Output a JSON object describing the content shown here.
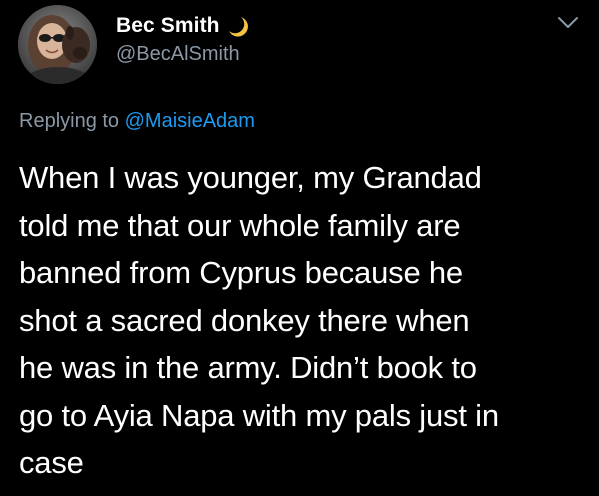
{
  "tweet": {
    "author": {
      "display_name": "Bec Smith",
      "handle": "@BecAlSmith",
      "name_emoji": "moon-icon"
    },
    "reply": {
      "prefix": "Replying to ",
      "mention": "@MaisieAdam"
    },
    "text_lines": [
      "When I was younger, my Grandad",
      "told me that our whole family are",
      "banned from Cyprus because he",
      "shot a sacred donkey there when",
      "he was in the army. Didn’t book to",
      "go to Ayia Napa with my pals just in",
      "case"
    ]
  },
  "colors": {
    "background": "#000000",
    "primary_text": "#ffffff",
    "secondary_text": "#8b98a5",
    "link": "#1d9bf0",
    "moon": "#f5c542"
  }
}
